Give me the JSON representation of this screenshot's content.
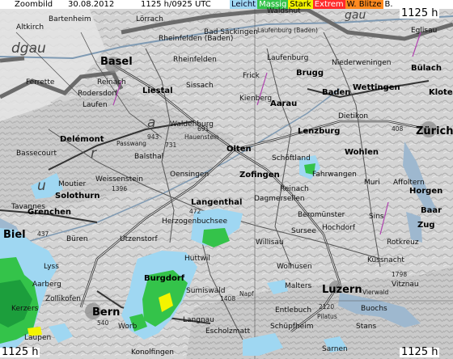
{
  "header": {
    "zoom_label": "Zoombild",
    "date": "30.08.2012",
    "time": "1125 h/0925 UTC",
    "height_label": "1125 h"
  },
  "legend": [
    {
      "label": "Leicht",
      "color": "#9fd7f2",
      "text_color": "#002"
    },
    {
      "label": "Massig",
      "color": "#34c34a",
      "text_color": "#fff"
    },
    {
      "label": "Stark",
      "color": "#f4f400",
      "text_color": "#000"
    },
    {
      "label": "Extrem",
      "color": "#ff2a2a",
      "text_color": "#fff"
    },
    {
      "label": "W. Blitze",
      "color": "#ff8a1f",
      "text_color": "#000"
    },
    {
      "label": "B.",
      "color": "#ffffff",
      "text_color": "#000"
    }
  ],
  "footer": {
    "bottom_left": "1125 h",
    "bottom_right": "1125 h"
  },
  "places": {
    "altkirch": "Altkirch",
    "bartenheim": "Bartenheim",
    "lorrach": "Lörrach",
    "waldshut": "Waldshut",
    "bad_sackingen": "Bad Säckingen",
    "laufenburg_baden": "Laufenburg (Baden)",
    "rheinfelden_baden": "Rheinfelden (Baden)",
    "rheinfelden": "Rheinfelden",
    "basel": "Basel",
    "laufenburg": "Laufenburg",
    "niederweningen": "Niederweningen",
    "bulach": "Bülach",
    "eglisau": "Eglisau",
    "ferrette": "Ferrette",
    "reinach": "Reinach",
    "rodersdorf": "Rodersdorf",
    "liestal": "Liestal",
    "sissach": "Sissach",
    "frick": "Frick",
    "brugg": "Brugg",
    "baden": "Baden",
    "wettingen": "Wettingen",
    "kloten": "Kloten",
    "laufen": "Laufen",
    "kienberg": "Kienberg",
    "aarau": "Aarau",
    "dietikon": "Dietikon",
    "zurich": "Zürich",
    "waldenburg": "Waldenburg",
    "hauenstein": "Hauenstein",
    "lenzburg": "Lenzburg",
    "delemont": "Delémont",
    "passwang": "Passwang",
    "balsthal": "Balsthal",
    "olten": "Olten",
    "schottland": "Schöftland",
    "wohlen": "Wohlen",
    "bassecourt": "Bassecourt",
    "oensingen": "Oensingen",
    "zofingen": "Zofingen",
    "fahrwangen": "Fahrwangen",
    "muri": "Muri",
    "affoltern": "Affoltern",
    "weissenstein": "Weissenstein",
    "moutier": "Moutier",
    "reinach_ag": "Reinach",
    "dagmersellen": "Dagmersellen",
    "horgen": "Horgen",
    "solothurn": "Solothurn",
    "langenthal": "Langenthal",
    "tavannes": "Tavannes",
    "grenchen": "Grenchen",
    "herzogenbuchsee": "Herzogenbuchsee",
    "beromunster": "Beromünster",
    "hochdorf": "Hochdorf",
    "sins": "Sins",
    "baar": "Baar",
    "zug": "Zug",
    "biel": "Biel",
    "buren": "Büren",
    "utzenstorf": "Utzenstorf",
    "willisau": "Willisau",
    "sursee": "Sursee",
    "rotkreuz": "Rotkreuz",
    "lyss": "Lyss",
    "huttwil": "Huttwil",
    "wolhusen": "Wolhusen",
    "kussnacht": "Küssnacht",
    "aarberg": "Aarberg",
    "burgdorf": "Burgdorf",
    "sumiswald": "Sumiswald",
    "malters": "Malters",
    "luzern": "Luzern",
    "vierwald": "Vierwald",
    "vitznau": "Vitznau",
    "zollikofen": "Zollikofen",
    "napf": "Napf",
    "kerzers": "Kerzers",
    "bern": "Bern",
    "worb": "Worb",
    "langnau": "Langnau",
    "entlebuch": "Entlebuch",
    "buochs": "Buochs",
    "laupen": "Laupen",
    "escholzmatt": "Escholzmatt",
    "schupfheim": "Schüpfheim",
    "pilatus": "Pilatus",
    "stans": "Stans",
    "sarnen": "Sarnen",
    "konolfingen": "Konolfingen",
    "region_a": "a",
    "region_r": "r",
    "region_u": "u",
    "region_gau": "gau",
    "region_dgau": "dgau"
  },
  "elevations": {
    "e943": "943",
    "e731": "731",
    "e691": "691",
    "e1396": "1396",
    "e472": "472",
    "e437": "437",
    "e540": "540",
    "e1408": "1408",
    "e1798": "1798",
    "e2120": "2120",
    "e408": "408"
  }
}
